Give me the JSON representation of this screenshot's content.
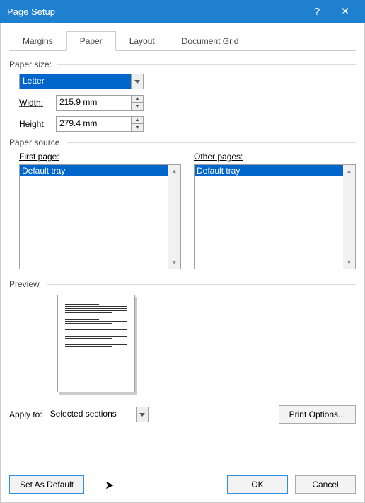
{
  "title": "Page Setup",
  "tabs": {
    "margins": "Margins",
    "paper": "Paper",
    "layout": "Layout",
    "grid": "Document Grid"
  },
  "paper_size": {
    "label": "Paper size:",
    "value": "Letter",
    "width_label": "Width:",
    "width_value": "215.9 mm",
    "height_label": "Height:",
    "height_value": "279.4 mm"
  },
  "paper_source": {
    "label": "Paper source",
    "first_label": "First page:",
    "other_label": "Other pages:",
    "first_value": "Default tray",
    "other_value": "Default tray"
  },
  "preview_label": "Preview",
  "apply": {
    "label": "Apply to:",
    "value": "Selected sections"
  },
  "buttons": {
    "print_options": "Print Options...",
    "set_default": "Set As Default",
    "ok": "OK",
    "cancel": "Cancel"
  }
}
